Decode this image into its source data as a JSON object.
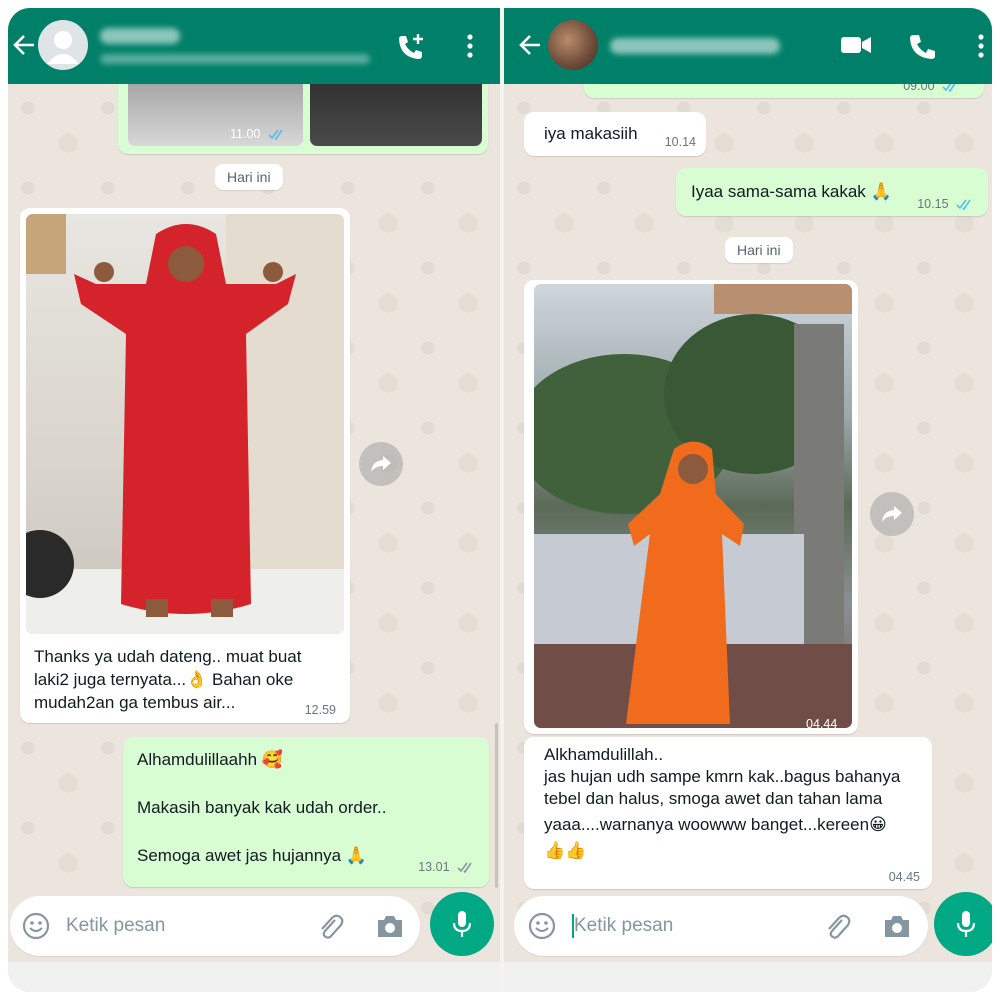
{
  "left_chat": {
    "input_placeholder": "Ketik pesan",
    "top_image_time": "11.00",
    "date_chip": "Hari ini",
    "photo_message": {
      "caption_line1": "Thanks ya udah dateng.. muat buat",
      "caption_line2": "laki2 juga ternyata...",
      "caption_line2_emoji": "👌",
      "caption_line2_rest": " Bahan oke",
      "caption_line3": "mudah2an ga tembus air...",
      "time": "12.59"
    },
    "reply": {
      "line1": "Alhamdulillaahh",
      "line1_emoji": "🥰",
      "line2": "Makasih banyak kak udah order..",
      "line3": "Semoga awet jas hujannya",
      "line3_emoji": "🙏",
      "time": "13.01"
    }
  },
  "right_chat": {
    "input_placeholder": "Ketik pesan",
    "top_time": "09.00",
    "msg1": {
      "text": "iya makasiih",
      "time": "10.14"
    },
    "msg2": {
      "text": "Iyaa sama-sama kakak",
      "emoji": "🙏",
      "time": "10.15"
    },
    "date_chip": "Hari ini",
    "photo_time": "04.44",
    "text_message": {
      "line1": "Alkhamdulillah..",
      "line2": "jas hujan udh sampe kmrn kak..bagus bahanya",
      "line3": "tebel dan halus, smoga awet dan tahan lama",
      "line4": "yaaa....warnanya woowww banget...kereen",
      "line4_emoji": "😀",
      "line5_emoji": "👍👍",
      "time": "04.45"
    }
  },
  "colors": {
    "header": "#008069",
    "outgoing": "#d9fdd3",
    "incoming": "#ffffff",
    "chat_bg": "#ece5dd",
    "mic": "#00a884",
    "read_ticks": "#53bdeb"
  }
}
